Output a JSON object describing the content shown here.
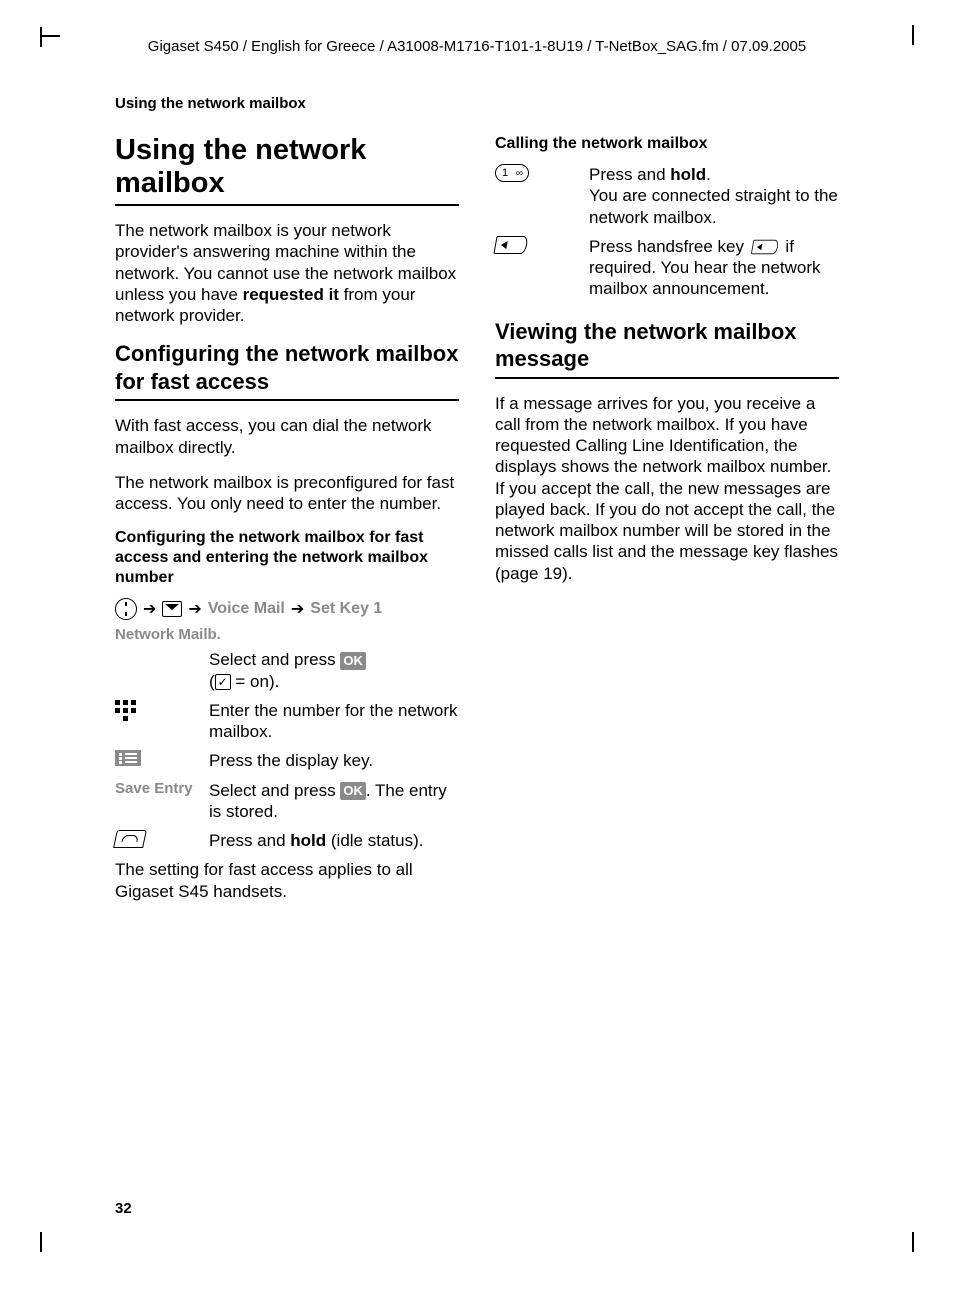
{
  "meta": {
    "header": "Gigaset S450 / English for Greece / A31008-M1716-T101-1-8U19 / T-NetBox_SAG.fm / 07.09.2005",
    "running_head": "Using the network mailbox",
    "page_number": "32"
  },
  "left": {
    "title": "Using the network mailbox",
    "intro_a": "The network mailbox is your network provider's answering machine within the network. You cannot use the network mailbox unless you have ",
    "intro_bold": "requested it",
    "intro_b": " from your network provider.",
    "h2_config": "Configuring the network mailbox for fast access",
    "p_fast1": "With fast access, you can dial the network mailbox directly.",
    "p_fast2": "The network mailbox is preconfigured for fast access. You only need to enter the number.",
    "h3_config": "Configuring the network mailbox for fast access and entering the network mailbox number",
    "path": {
      "voice_mail": "Voice Mail",
      "set_key": "Set Key 1"
    },
    "label_network_mailb": "Network Mailb.",
    "step_select_a": "Select and press ",
    "ok": "OK",
    "step_select_b": " ( ",
    "step_select_c": " = on).",
    "step_enter": "Enter the number for the network mailbox.",
    "step_press_display": "Press the display key.",
    "label_save_entry": "Save Entry",
    "step_save_a": "Select and press ",
    "step_save_b": ". The entry is stored.",
    "step_hangup_a": "Press and ",
    "step_hangup_bold": "hold",
    "step_hangup_b": " (idle status).",
    "p_applies": "The setting for fast access applies to all Gigaset S45 handsets."
  },
  "right": {
    "h3_calling": "Calling the network mailbox",
    "row1_a": "Press and ",
    "row1_bold": "hold",
    "row1_b": ".",
    "row1_c": "You are connected straight to the network mailbox.",
    "row2_a": "Press handsfree key ",
    "row2_b": " if required. You hear the network mailbox announcement.",
    "h2_viewing": "Viewing the network mailbox message",
    "p_viewing": "If a message arrives for you, you receive a call from the network mailbox. If you have requested Calling Line Identification, the displays shows the network mailbox number. If you accept the call, the new messages are played back. If you do not accept the call, the network mailbox number will be stored in the missed calls list and the message key flashes (page 19)."
  }
}
